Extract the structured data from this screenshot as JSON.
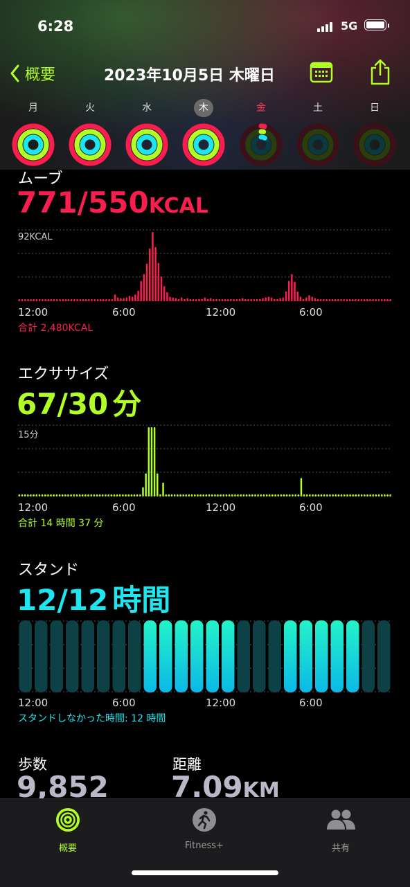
{
  "status": {
    "time": "6:28",
    "network": "5G"
  },
  "nav": {
    "back_label": "概要",
    "title": "2023年10月5日 木曜日"
  },
  "colors": {
    "move": "#fa1e4e",
    "exercise": "#b2ff26",
    "stand": "#1ee6f0",
    "accent": "#b2ff26"
  },
  "week": [
    {
      "label": "月",
      "move": 1.0,
      "exercise": 1.0,
      "stand": 1.0
    },
    {
      "label": "火",
      "move": 1.0,
      "exercise": 1.0,
      "stand": 1.0
    },
    {
      "label": "水",
      "move": 1.0,
      "exercise": 1.0,
      "stand": 1.0
    },
    {
      "label": "木",
      "move": 1.0,
      "exercise": 1.0,
      "stand": 1.0,
      "today": true
    },
    {
      "label": "金",
      "move": 0.03,
      "exercise": 0.03,
      "stand": 0.08
    },
    {
      "label": "土",
      "move": 0,
      "exercise": 0,
      "stand": 0
    },
    {
      "label": "日",
      "move": 0,
      "exercise": 0,
      "stand": 0
    }
  ],
  "move": {
    "label": "ムーブ",
    "value": "771/550",
    "unit": "KCAL",
    "max_label": "92KCAL",
    "total": "合計 2,480KCAL",
    "ticks": [
      "12:00",
      "6:00",
      "12:00",
      "6:00"
    ]
  },
  "exercise": {
    "label": "エクササイズ",
    "value": "67/30",
    "unit": "分",
    "max_label": "15分",
    "total": "合計 14 時間 37 分",
    "ticks": [
      "12:00",
      "6:00",
      "12:00",
      "6:00"
    ]
  },
  "stand": {
    "label": "スタンド",
    "value": "12/12",
    "unit": "時間",
    "note": "スタンドしなかった時間: 12 時間",
    "ticks": [
      "12:00",
      "6:00",
      "12:00",
      "6:00"
    ]
  },
  "steps": {
    "label": "歩数",
    "value": "9,852"
  },
  "distance": {
    "label": "距離",
    "value": "7.09",
    "unit": "KM"
  },
  "tabs": [
    {
      "label": "概要",
      "active": true
    },
    {
      "label": "Fitness+",
      "active": false
    },
    {
      "label": "共有",
      "active": false
    }
  ],
  "chart_data": [
    {
      "type": "bar",
      "title": "ムーブ",
      "ylabel": "KCAL",
      "ylim": [
        0,
        92
      ],
      "x_ticks": [
        "12:00",
        "6:00",
        "12:00",
        "6:00"
      ],
      "values": [
        2,
        2,
        2,
        2,
        2,
        2,
        2,
        2,
        2,
        2,
        2,
        2,
        2,
        2,
        2,
        2,
        2,
        2,
        2,
        2,
        2,
        2,
        2,
        2,
        2,
        2,
        2,
        2,
        2,
        2,
        2,
        2,
        2,
        9,
        5,
        4,
        4,
        5,
        7,
        6,
        9,
        14,
        27,
        36,
        50,
        70,
        92,
        72,
        51,
        33,
        20,
        12,
        6,
        5,
        4,
        3,
        5,
        3,
        4,
        3,
        2,
        2,
        3,
        3,
        5,
        3,
        4,
        2,
        3,
        2,
        2,
        2,
        2,
        2,
        2,
        2,
        3,
        4,
        3,
        2,
        3,
        2,
        2,
        3,
        4,
        5,
        6,
        5,
        3,
        3,
        4,
        5,
        13,
        27,
        36,
        26,
        13,
        6,
        3,
        5,
        8,
        6,
        4,
        3,
        2,
        2,
        2,
        2,
        2,
        2,
        2,
        2,
        2,
        2,
        2,
        2,
        2,
        2,
        2,
        2,
        2,
        2,
        2,
        2,
        2,
        2,
        2,
        2,
        2
      ]
    },
    {
      "type": "bar",
      "title": "エクササイズ",
      "ylabel": "分",
      "ylim": [
        0,
        15
      ],
      "x_ticks": [
        "12:00",
        "6:00",
        "12:00",
        "6:00"
      ],
      "values": [
        0,
        0,
        0,
        0,
        0,
        0,
        0,
        0,
        0,
        0,
        0,
        0,
        0,
        0,
        0,
        0,
        0,
        0,
        0,
        0,
        0,
        0,
        0,
        0,
        0,
        0,
        0,
        0,
        0,
        0,
        0,
        0,
        0,
        0,
        0,
        0,
        0,
        0,
        0,
        0,
        0,
        0,
        0,
        2,
        5,
        15,
        15,
        15,
        5,
        0,
        3,
        0,
        0,
        0,
        0,
        0,
        0,
        0,
        0,
        0,
        0,
        0,
        0,
        0,
        0,
        0,
        0,
        0,
        0,
        0,
        0,
        0,
        0,
        0,
        0,
        0,
        0,
        0,
        0,
        0,
        0,
        0,
        0,
        0,
        0,
        0,
        0,
        0,
        0,
        0,
        0,
        0,
        0,
        0,
        0,
        0,
        0,
        0,
        4,
        0,
        0,
        0,
        0,
        0,
        0,
        0,
        0,
        0,
        0,
        0,
        0,
        0,
        0,
        0,
        0,
        0,
        0,
        0,
        0,
        0,
        0,
        0,
        0,
        0,
        0,
        0,
        0,
        0,
        0,
        0
      ]
    },
    {
      "type": "bar",
      "title": "スタンド",
      "x_ticks": [
        "12:00",
        "6:00",
        "12:00",
        "6:00"
      ],
      "values": [
        0,
        0,
        0,
        0,
        0,
        0,
        0,
        0,
        1,
        1,
        1,
        1,
        1,
        1,
        0,
        0,
        0,
        1,
        1,
        1,
        1,
        1,
        0,
        0
      ]
    }
  ]
}
